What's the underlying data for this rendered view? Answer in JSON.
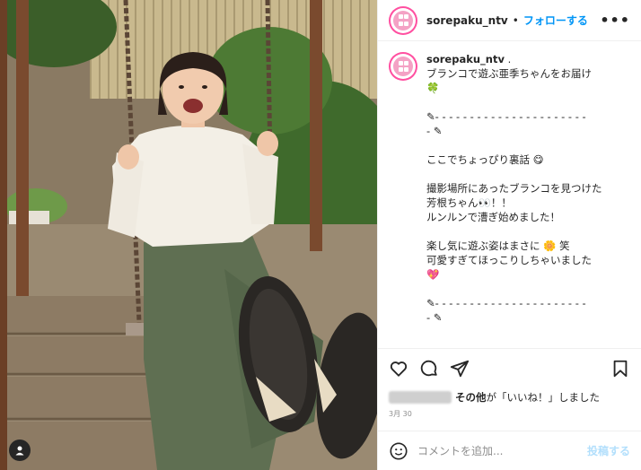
{
  "header": {
    "username": "sorepaku_ntv",
    "separator": "•",
    "follow_label": "フォローする",
    "more_label": "•••"
  },
  "caption": {
    "username": "sorepaku_ntv",
    "username_suffix": ".",
    "lines": [
      "ブランコで遊ぶ亜季ちゃんをお届け",
      "🍀",
      "",
      "✎- - - - - - - - - - - - - - - - - - - - - -",
      "- ✎",
      "",
      "ここでちょっぴり裏話 😋",
      "",
      "撮影場所にあったブランコを見つけた",
      "芳根ちゃん👀！！",
      "ルンルンで漕ぎ始めました！",
      "",
      "楽し気に遊ぶ姿はまさに 🌼 笑",
      "可愛すぎてほっこりしちゃいました",
      "💖",
      "",
      "✎- - - - - - - - - - - - - - - - - - - - - -",
      "- ✎"
    ]
  },
  "likes": {
    "text_bold": "その他",
    "text_rest": "が「いいね！」しました"
  },
  "date": "3月 30",
  "comment": {
    "placeholder": "コメントを追加...",
    "post_label": "投稿する"
  },
  "colors": {
    "link_blue": "#0095f6",
    "post_disabled": "#b2dffc",
    "avatar_ring": "#ff4fa0"
  }
}
